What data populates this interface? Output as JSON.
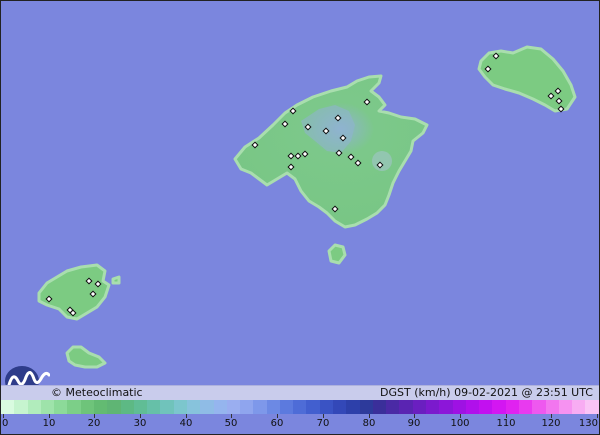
{
  "map": {
    "colors": {
      "sea": "#7b86de",
      "land": "#7ccb82",
      "land_edge": "#a9deae",
      "land_dark": "#62ba6f",
      "highland": "#9ab8d8"
    },
    "stations_marker": "open-square-marker"
  },
  "footer": {
    "copyright": "© Meteoclimatic",
    "product": "DGST (km/h)  09-02-2021 @ 23:51 UTC",
    "logo_icon": "meteoclimatic-wave-logo-icon"
  },
  "legend": {
    "unit": "km/h",
    "tick_labels": [
      "0",
      "10",
      "20",
      "30",
      "40",
      "50",
      "60",
      "70",
      "80",
      "90",
      "100",
      "110",
      "120",
      "130"
    ],
    "colors": [
      "#d9fbe0",
      "#c6f4cf",
      "#b1ecbc",
      "#9ee3aa",
      "#8cda99",
      "#7ccf88",
      "#6ec47a",
      "#63bb72",
      "#5fb574",
      "#5db984",
      "#60bd95",
      "#66c0a8",
      "#70c3bb",
      "#7cc6cd",
      "#87c3dc",
      "#8fbce6",
      "#95b5ee",
      "#9aaef0",
      "#8fa5ee",
      "#7e98ea",
      "#6c89e4",
      "#5c7ade",
      "#4e6cd7",
      "#425fcf",
      "#3a53c4",
      "#3348b8",
      "#2d40aa",
      "#2d3a9b",
      "#3a2f9a",
      "#4a2aa5",
      "#5a24b2",
      "#6a1fc0",
      "#7b1acd",
      "#8c16d9",
      "#9e12e3",
      "#b010eb",
      "#c210f0",
      "#d316f2",
      "#e022f0",
      "#e83aef",
      "#ee58ef",
      "#f276ef",
      "#f692f1",
      "#f8acf3",
      "#fac4f6"
    ]
  }
}
